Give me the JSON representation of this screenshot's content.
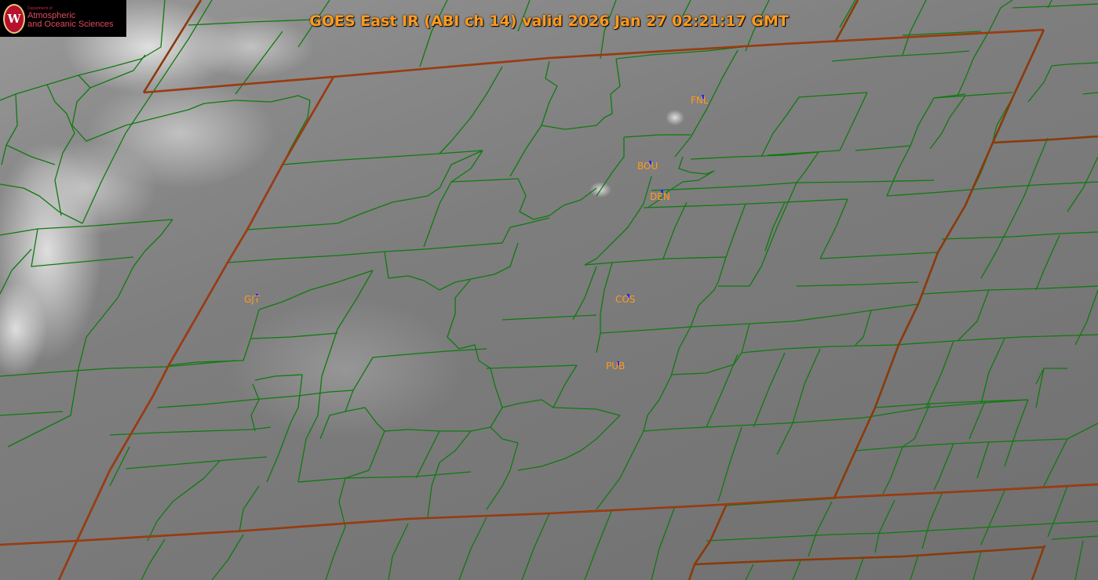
{
  "title": "GOES East IR (ABI ch 14) valid 2026 Jan 27 02:21:17 GMT",
  "logo": {
    "seal_letter": "W",
    "dept_line": "Department of",
    "line1": "Atmospheric",
    "line2": "and Oceanic Sciences"
  },
  "stations": [
    {
      "id": "FNL"
    },
    {
      "id": "BOU"
    },
    {
      "id": "DEN"
    },
    {
      "id": "GJT"
    },
    {
      "id": "COS"
    },
    {
      "id": "PUB"
    }
  ],
  "colors": {
    "county_lines": "#0f7a0f",
    "state_lines": "#8a3a0a",
    "labels": "#ff9a1e",
    "station_marker": "#1a2cff"
  }
}
